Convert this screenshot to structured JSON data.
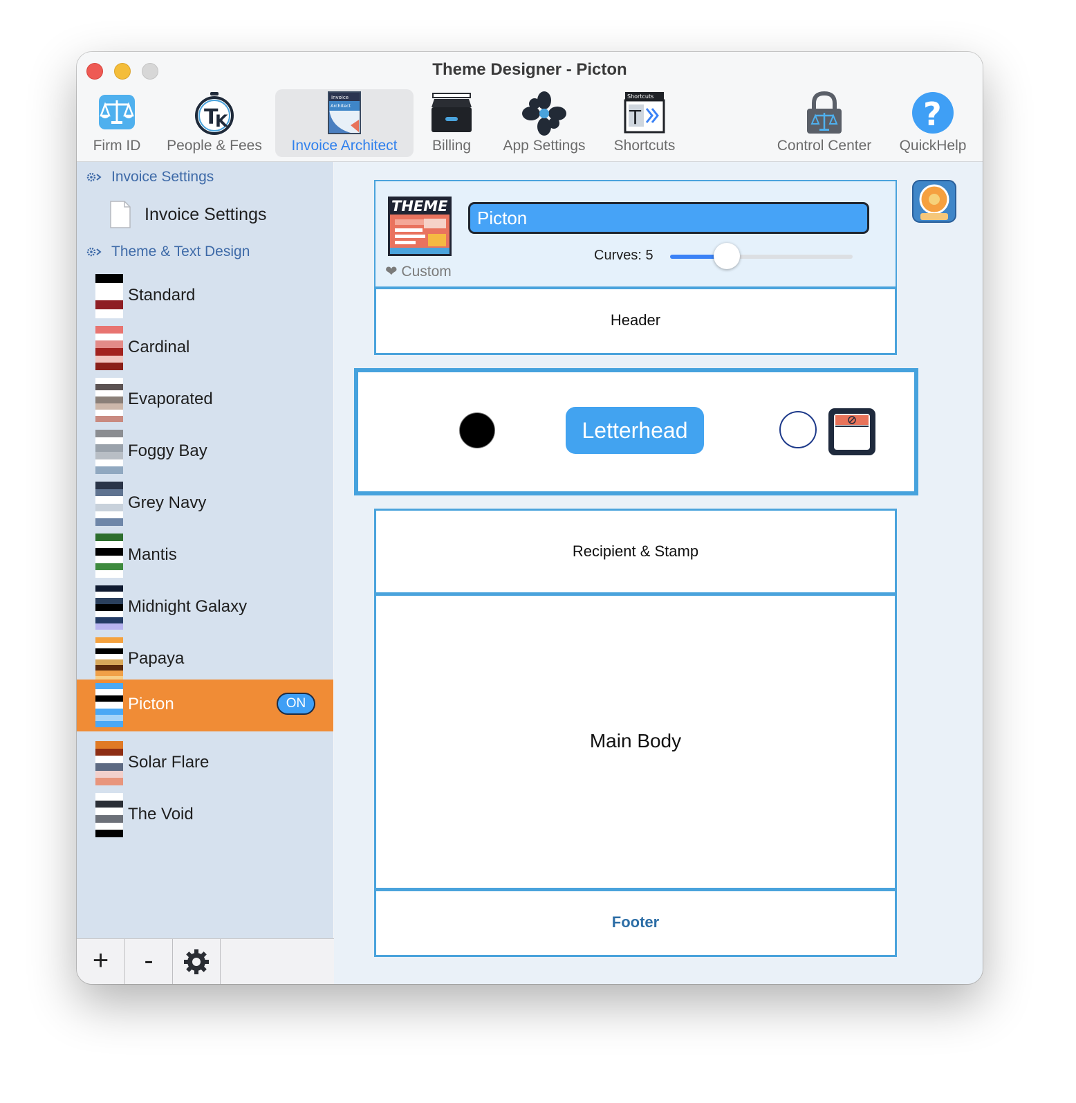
{
  "window": {
    "title": "Theme Designer - Picton"
  },
  "toolbar": {
    "items": [
      {
        "label": "Firm ID",
        "icon": "scales-icon"
      },
      {
        "label": "People & Fees",
        "icon": "tk-stopwatch-icon"
      },
      {
        "label": "Invoice Architect",
        "icon": "invoice-architect-icon",
        "active": true
      },
      {
        "label": "Billing",
        "icon": "filing-cabinet-icon"
      },
      {
        "label": "App Settings",
        "icon": "flower-gear-icon"
      },
      {
        "label": "Shortcuts",
        "icon": "shortcuts-icon"
      },
      {
        "label": "Control Center",
        "icon": "lock-scales-icon"
      },
      {
        "label": "QuickHelp",
        "icon": "question-icon"
      }
    ],
    "doc_icon_labels": {
      "invoice": "Invoice",
      "architect": "Architect",
      "shortcuts": "Shortcuts"
    }
  },
  "sidebar": {
    "section1": "Invoice Settings",
    "section1_item": "Invoice Settings",
    "section2": "Theme & Text Design",
    "themes": [
      {
        "name": "Standard",
        "colors": [
          "#000000",
          "#ffffff",
          "#ffffff",
          "#8e1e24",
          "#ffffff"
        ]
      },
      {
        "name": "Cardinal",
        "colors": [
          "#e87470",
          "#ffffff",
          "#e38b88",
          "#a2231f",
          "#f2c6c0",
          "#8a1f18"
        ]
      },
      {
        "name": "Evaporated",
        "colors": [
          "#ffffff",
          "#5b5252",
          "#ffffff",
          "#8a7f78",
          "#ccb7aa",
          "#ffffff",
          "#c98a80"
        ]
      },
      {
        "name": "Foggy Bay",
        "colors": [
          "#8b8d91",
          "#ffffff",
          "#9aa2ab",
          "#b8bec5",
          "#ffffff",
          "#90a8c0"
        ]
      },
      {
        "name": "Grey Navy",
        "colors": [
          "#2a3447",
          "#5f7390",
          "#ffffff",
          "#c8d1db",
          "#ffffff",
          "#6e86a8"
        ]
      },
      {
        "name": "Mantis",
        "colors": [
          "#2d6e2d",
          "#ffffff",
          "#000000",
          "#ffffff",
          "#3e8a3e",
          "#ffffff"
        ]
      },
      {
        "name": "Midnight Galaxy",
        "colors": [
          "#0f1a30",
          "#ffffff",
          "#2a3f5c",
          "#000000",
          "#ffffff",
          "#243c66",
          "#b8b4f0"
        ]
      },
      {
        "name": "Papaya",
        "colors": [
          "#f4a13d",
          "#ffffff",
          "#000000",
          "#ffffff",
          "#d8a85a",
          "#5a2a0c",
          "#f0a048",
          "#f6cf8a"
        ]
      },
      {
        "name": "Picton",
        "colors": [
          "#4aa8f5",
          "#ffffff",
          "#000000",
          "#ffffff",
          "#4aa8f5",
          "#a6d4f8",
          "#4aa8f5"
        ],
        "active": true,
        "badge": "ON"
      },
      {
        "name": "Solar Flare",
        "colors": [
          "#e07a25",
          "#8e2e14",
          "#ffffff",
          "#5d6a82",
          "#f2d0cc",
          "#e8957c"
        ]
      },
      {
        "name": "The Void",
        "colors": [
          "#ffffff",
          "#2b2f36",
          "#ffffff",
          "#6c7078",
          "#ffffff",
          "#000000"
        ]
      }
    ]
  },
  "bottom_bar": {
    "add_label": "+",
    "remove_label": "-"
  },
  "theme_editor": {
    "logo_text": "THEME",
    "custom_label": "❤ Custom",
    "theme_name": "Picton",
    "curves_label": "Curves: 5",
    "curves_value": 5,
    "curves_fraction": 0.31
  },
  "sections": {
    "header": "Header",
    "letterhead": "Letterhead",
    "recipient": "Recipient & Stamp",
    "main_body": "Main Body",
    "footer": "Footer"
  },
  "colors": {
    "accent": "#2f80ed",
    "section_border": "#4aa3dc",
    "active_theme": "#f08c36",
    "sidebar_bg": "#d6e1ee"
  }
}
